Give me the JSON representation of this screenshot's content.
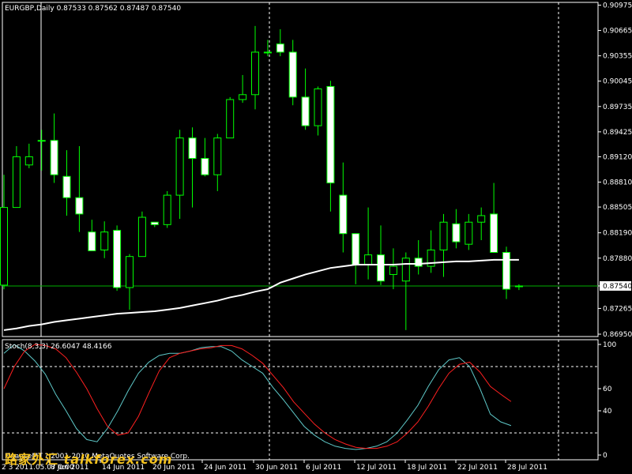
{
  "header": {
    "main_title": "EURGBP,Daily  0.87533 0.87562 0.87487 0.87540",
    "stoch_title": "Stoch(8,3,3) 26.6047 48.4166",
    "copyright": "FinanceMT ? 2001-2010 MetaQuotes Software Corp.",
    "cursor_date": "2 3 2011.05.07 0:00"
  },
  "watermark": {
    "cn": "路家外汇",
    "en": "talkforex.com"
  },
  "colors": {
    "background": "#000000",
    "candle_wick": "#00ff00",
    "candle_bull_fill": "#000000",
    "candle_bear_fill": "#ffffff",
    "ma_line": "#ffffff",
    "stoch_main": "#5ec8c8",
    "stoch_signal": "#ff2020",
    "price_line": "#00b000",
    "grid_dash": "#ffffff"
  },
  "chart_data": [
    {
      "type": "candlestick",
      "title": "EURGBP,Daily",
      "ylim": [
        0.8695,
        0.9097
      ],
      "y_ticks": [
        "0.90975",
        "0.90665",
        "0.90355",
        "0.90045",
        "0.89735",
        "0.89425",
        "0.89120",
        "0.88810",
        "0.88505",
        "0.88190",
        "0.87880",
        "0.87540",
        "0.87265",
        "0.86950"
      ],
      "y_tick_values": [
        0.90975,
        0.90665,
        0.90355,
        0.90045,
        0.89735,
        0.89425,
        0.8912,
        0.8881,
        0.88505,
        0.8819,
        0.8788,
        0.8754,
        0.87265,
        0.8695
      ],
      "current_price": "0.87540",
      "current_price_value": 0.8754,
      "x_labels": [
        "2 3 2011",
        "8 Jun 2011",
        "14 Jun 2011",
        "20 Jun 2011",
        "24 Jun 2011",
        "30 Jun 2011",
        "6 Jul 2011",
        "12 Jul 2011",
        "18 Jul 2011",
        "22 Jul 2011",
        "28 Jul 2011"
      ],
      "candles": [
        {
          "o": 0.8755,
          "h": 0.889,
          "l": 0.875,
          "c": 0.885
        },
        {
          "o": 0.885,
          "h": 0.8925,
          "l": 0.885,
          "c": 0.8912
        },
        {
          "o": 0.8902,
          "h": 0.8928,
          "l": 0.8898,
          "c": 0.8912
        },
        {
          "o": 0.8932,
          "h": 0.8945,
          "l": 0.8895,
          "c": 0.8932
        },
        {
          "o": 0.8932,
          "h": 0.8965,
          "l": 0.888,
          "c": 0.889
        },
        {
          "o": 0.8888,
          "h": 0.892,
          "l": 0.884,
          "c": 0.8862
        },
        {
          "o": 0.8862,
          "h": 0.8925,
          "l": 0.882,
          "c": 0.8842
        },
        {
          "o": 0.882,
          "h": 0.8835,
          "l": 0.8797,
          "c": 0.8797
        },
        {
          "o": 0.8798,
          "h": 0.8833,
          "l": 0.8788,
          "c": 0.882
        },
        {
          "o": 0.8822,
          "h": 0.8828,
          "l": 0.8748,
          "c": 0.8752
        },
        {
          "o": 0.8752,
          "h": 0.8793,
          "l": 0.8725,
          "c": 0.879
        },
        {
          "o": 0.879,
          "h": 0.8845,
          "l": 0.879,
          "c": 0.8838
        },
        {
          "o": 0.8832,
          "h": 0.8832,
          "l": 0.8826,
          "c": 0.8829
        },
        {
          "o": 0.8829,
          "h": 0.887,
          "l": 0.8825,
          "c": 0.8865
        },
        {
          "o": 0.8865,
          "h": 0.8945,
          "l": 0.8836,
          "c": 0.8935
        },
        {
          "o": 0.8935,
          "h": 0.8948,
          "l": 0.885,
          "c": 0.891
        },
        {
          "o": 0.891,
          "h": 0.8935,
          "l": 0.8888,
          "c": 0.889
        },
        {
          "o": 0.889,
          "h": 0.894,
          "l": 0.887,
          "c": 0.8935
        },
        {
          "o": 0.8935,
          "h": 0.8985,
          "l": 0.8935,
          "c": 0.8982
        },
        {
          "o": 0.8982,
          "h": 0.9012,
          "l": 0.8978,
          "c": 0.8988
        },
        {
          "o": 0.8988,
          "h": 0.9072,
          "l": 0.897,
          "c": 0.904
        },
        {
          "o": 0.904,
          "h": 0.9055,
          "l": 0.9035,
          "c": 0.904
        },
        {
          "o": 0.905,
          "h": 0.9068,
          "l": 0.9035,
          "c": 0.904
        },
        {
          "o": 0.904,
          "h": 0.9055,
          "l": 0.8975,
          "c": 0.8985
        },
        {
          "o": 0.8985,
          "h": 0.902,
          "l": 0.8945,
          "c": 0.895
        },
        {
          "o": 0.895,
          "h": 0.8998,
          "l": 0.8938,
          "c": 0.8995
        },
        {
          "o": 0.8998,
          "h": 0.9005,
          "l": 0.8845,
          "c": 0.888
        },
        {
          "o": 0.8865,
          "h": 0.8905,
          "l": 0.8795,
          "c": 0.8818
        },
        {
          "o": 0.8818,
          "h": 0.8818,
          "l": 0.8756,
          "c": 0.878
        },
        {
          "o": 0.878,
          "h": 0.885,
          "l": 0.8762,
          "c": 0.8792
        },
        {
          "o": 0.8792,
          "h": 0.8828,
          "l": 0.8755,
          "c": 0.876
        },
        {
          "o": 0.8768,
          "h": 0.88,
          "l": 0.875,
          "c": 0.8778
        },
        {
          "o": 0.876,
          "h": 0.8795,
          "l": 0.87,
          "c": 0.8788
        },
        {
          "o": 0.8788,
          "h": 0.881,
          "l": 0.8768,
          "c": 0.8778
        },
        {
          "o": 0.8778,
          "h": 0.8822,
          "l": 0.877,
          "c": 0.8798
        },
        {
          "o": 0.8798,
          "h": 0.8842,
          "l": 0.8765,
          "c": 0.8832
        },
        {
          "o": 0.883,
          "h": 0.8848,
          "l": 0.88,
          "c": 0.8808
        },
        {
          "o": 0.8805,
          "h": 0.8842,
          "l": 0.8798,
          "c": 0.8832
        },
        {
          "o": 0.8832,
          "h": 0.885,
          "l": 0.881,
          "c": 0.884
        },
        {
          "o": 0.8842,
          "h": 0.888,
          "l": 0.882,
          "c": 0.8795
        },
        {
          "o": 0.8795,
          "h": 0.8802,
          "l": 0.8738,
          "c": 0.875
        },
        {
          "o": 0.8753,
          "h": 0.8756,
          "l": 0.8749,
          "c": 0.8754
        }
      ],
      "ma": [
        0.87,
        0.8702,
        0.8705,
        0.8707,
        0.871,
        0.8712,
        0.8714,
        0.8716,
        0.8718,
        0.872,
        0.8721,
        0.8722,
        0.8723,
        0.8725,
        0.8727,
        0.873,
        0.8733,
        0.8736,
        0.874,
        0.8743,
        0.8747,
        0.875,
        0.8758,
        0.8763,
        0.8768,
        0.8772,
        0.8776,
        0.8778,
        0.878,
        0.878,
        0.878,
        0.878,
        0.8781,
        0.8781,
        0.8782,
        0.8783,
        0.8784,
        0.8784,
        0.8785,
        0.8786,
        0.8786,
        0.8786
      ]
    },
    {
      "type": "line",
      "title": "Stoch(8,3,3)",
      "ylim": [
        0,
        100
      ],
      "y_ticks": [
        "100",
        "60",
        "40",
        "0"
      ],
      "y_tick_values": [
        100,
        60,
        40,
        0
      ],
      "levels": [
        80,
        20
      ],
      "series": [
        {
          "name": "main",
          "values": [
            92,
            100,
            94,
            85,
            73,
            55,
            40,
            24,
            14,
            12,
            24,
            40,
            58,
            74,
            84,
            90,
            92,
            92,
            94,
            97,
            98,
            98,
            94,
            86,
            80,
            74,
            61,
            50,
            38,
            26,
            18,
            12,
            8,
            6,
            5,
            6,
            8,
            12,
            20,
            32,
            45,
            62,
            77,
            86,
            88,
            80,
            60,
            37,
            30,
            26.6
          ]
        },
        {
          "name": "signal",
          "values": [
            60,
            80,
            94,
            100,
            99,
            96,
            88,
            75,
            60,
            42,
            26,
            18,
            20,
            35,
            56,
            76,
            88,
            92,
            94,
            96,
            97,
            99,
            99,
            96,
            90,
            83,
            72,
            61,
            48,
            38,
            28,
            20,
            14,
            10,
            7,
            6,
            6,
            8,
            12,
            20,
            30,
            44,
            60,
            74,
            82,
            84,
            75,
            62,
            55,
            48.4
          ]
        }
      ]
    }
  ]
}
